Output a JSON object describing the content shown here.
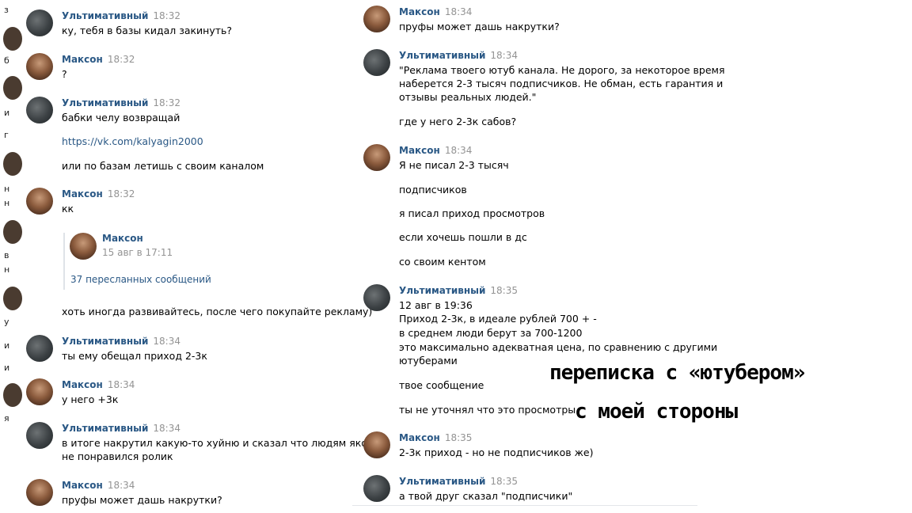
{
  "left_strip": [
    "з",
    "б",
    "и",
    "г",
    "н",
    "н",
    "в",
    "н",
    "у",
    "и",
    "и",
    "я"
  ],
  "left_column": {
    "messages": [
      {
        "author": "Ультимативный",
        "time": "18:32",
        "lines": [
          "ку, тебя в базы кидал закинуть?"
        ]
      },
      {
        "author": "Максон",
        "time": "18:32",
        "lines": [
          "?"
        ]
      },
      {
        "author": "Ультимативный",
        "time": "18:32",
        "lines": [
          "бабки челу возвращай",
          "https://vk.com/kalyagin2000",
          "или по базам летишь с своим каналом"
        ]
      },
      {
        "author": "Максон",
        "time": "18:32",
        "lines": [
          "кк"
        ]
      },
      {
        "author": "Ультимативный",
        "time": "18:34",
        "lines": [
          "ты ему обещал приход 2-3к"
        ]
      },
      {
        "author": "Максон",
        "time": "18:34",
        "lines": [
          "у него +3к"
        ]
      },
      {
        "author": "Ультимативный",
        "time": "18:34",
        "lines": [
          "в итоге накрутил какую-то хуйню и сказал что людям якобы",
          "не понравился ролик"
        ]
      },
      {
        "author": "Максон",
        "time": "18:34",
        "lines": [
          "пруфы может дашь накрутки?"
        ]
      }
    ],
    "forwarded": {
      "author": "Максон",
      "date": "15 авг в 17:11",
      "count_label": "37 пересланных сообщений",
      "after_text": "хоть иногда развивайтесь, после чего покупайте рекламу)"
    }
  },
  "right_column": {
    "messages": [
      {
        "author": "Максон",
        "time": "18:34",
        "lines": [
          "пруфы может дашь накрутки?"
        ]
      },
      {
        "author": "Ультимативный",
        "time": "18:34",
        "lines": [
          "\"Реклама твоего ютуб канала. Не дорого, за некоторое время",
          "наберется 2-3 тысяч подписчиков. Не обман, есть гарантия и",
          "отзывы реальных людей.\"",
          "где у него 2-3к сабов?"
        ]
      },
      {
        "author": "Максон",
        "time": "18:34",
        "lines": [
          "Я не писал 2-3 тысяч",
          "подписчиков",
          "я писал приход просмотров",
          "если хочешь пошли в дс",
          "со своим кентом"
        ]
      },
      {
        "author": "Ультимативный",
        "time": "18:35",
        "lines": [
          "12 авг в 19:36",
          "Приход 2-3к, в идеале рублей 700 + -",
          "в среднем люди берут за 700-1200",
          "это максимально адекватная цена, по сравнению с другими",
          "ютуберами",
          "твое сообщение",
          "ты не уточнял что это просмотры"
        ]
      },
      {
        "author": "Максон",
        "time": "18:35",
        "lines": [
          "2-3к приход - но не подписчиков же)"
        ]
      },
      {
        "author": "Ультимативный",
        "time": "18:35",
        "lines": [
          "а твой друг сказал \"подписчики\""
        ]
      }
    ]
  },
  "annotation": {
    "line1": "переписка с «ютубером»",
    "line2": "с моей стороны"
  }
}
